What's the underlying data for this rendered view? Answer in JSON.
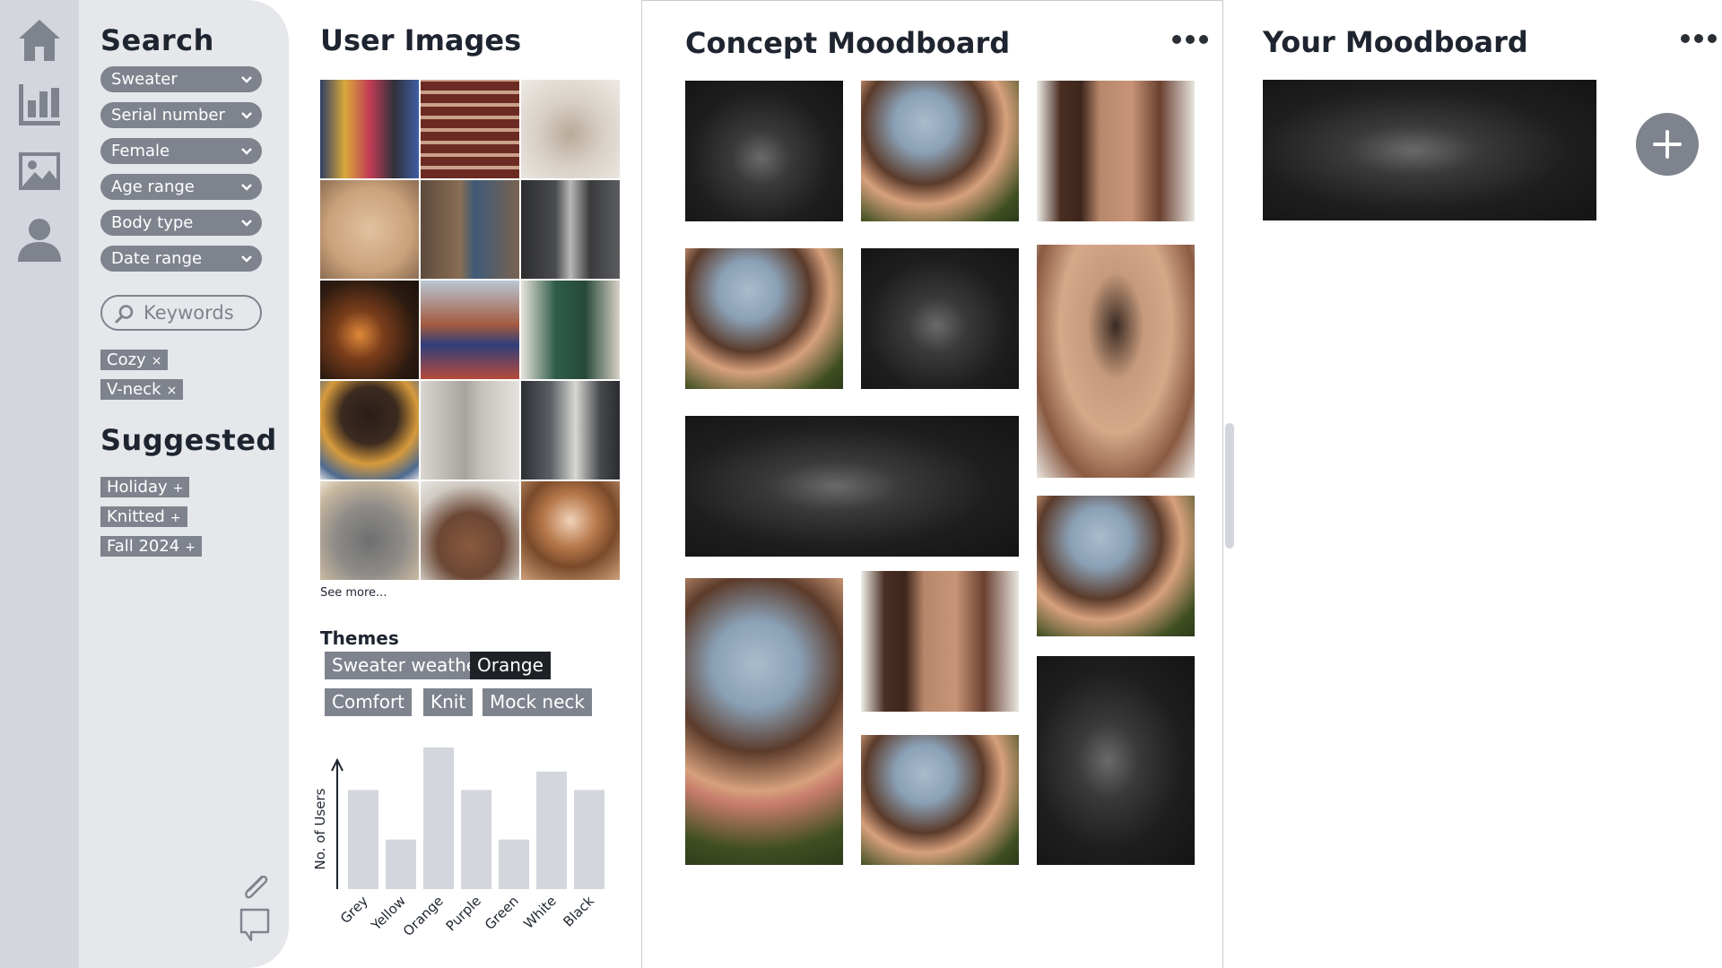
{
  "search": {
    "title": "Search",
    "filters": [
      {
        "label": "Sweater"
      },
      {
        "label": "Serial number"
      },
      {
        "label": "Female"
      },
      {
        "label": "Age range"
      },
      {
        "label": "Body type"
      },
      {
        "label": "Date range"
      }
    ],
    "keywords_placeholder": "Keywords",
    "active_tags": [
      {
        "label": "Cozy",
        "action": "×"
      },
      {
        "label": "V-neck",
        "action": "×"
      }
    ],
    "suggested_title": "Suggested",
    "suggested_tags": [
      {
        "label": "Holiday",
        "action": "+"
      },
      {
        "label": "Knitted",
        "action": "+"
      },
      {
        "label": "Fall 2024",
        "action": "+"
      }
    ]
  },
  "user_images": {
    "title": "User Images",
    "see_more": "See more...",
    "themes_title": "Themes",
    "themes": [
      {
        "label": "Sweater weather",
        "selected": false
      },
      {
        "label": "Orange",
        "selected": true
      },
      {
        "label": "Comfort",
        "selected": false
      },
      {
        "label": "Knit",
        "selected": false
      },
      {
        "label": "Mock neck",
        "selected": false
      }
    ]
  },
  "chart_data": {
    "type": "bar",
    "categories": [
      "Grey",
      "Yellow",
      "Orange",
      "Purple",
      "Green",
      "White",
      "Black"
    ],
    "values": [
      70,
      35,
      100,
      70,
      35,
      83,
      70
    ],
    "ylabel": "No. of Users",
    "xlabel": "",
    "title": "",
    "ylim": [
      0,
      100
    ],
    "bar_color": "#d3d6dd"
  },
  "concept": {
    "title": "Concept Moodboard"
  },
  "yours": {
    "title": "Your Moodboard"
  },
  "colors": {
    "rail": "#d3d6dd",
    "panel": "#e5e7ea",
    "pill": "#7e838d",
    "selected_theme": "#1e2126",
    "text": "#1e2530"
  },
  "icons": {
    "rail": [
      "home-icon",
      "bar-chart-icon",
      "image-icon",
      "user-icon"
    ],
    "tools": [
      "paperclip-icon",
      "comment-icon",
      "search-icon",
      "more-icon",
      "add-icon"
    ]
  }
}
